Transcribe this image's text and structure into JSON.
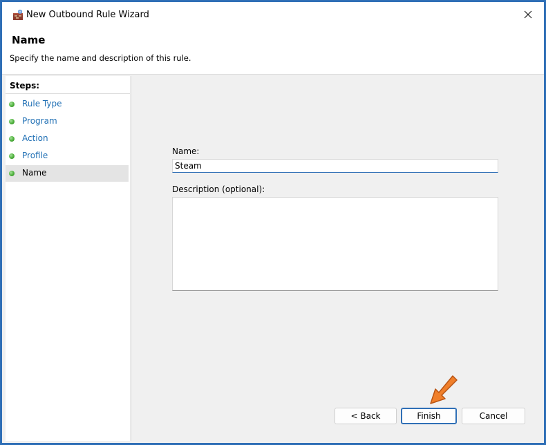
{
  "window": {
    "title": "New Outbound Rule Wizard",
    "app_icon": "firewall-icon",
    "close_icon": "close-icon"
  },
  "header": {
    "title": "Name",
    "subtitle": "Specify the name and description of this rule."
  },
  "steps": {
    "title": "Steps:",
    "items": [
      {
        "label": "Rule Type",
        "active": false
      },
      {
        "label": "Program",
        "active": false
      },
      {
        "label": "Action",
        "active": false
      },
      {
        "label": "Profile",
        "active": false
      },
      {
        "label": "Name",
        "active": true
      }
    ]
  },
  "form": {
    "name_label": "Name:",
    "name_value": "Steam",
    "description_label": "Description (optional):",
    "description_value": ""
  },
  "buttons": {
    "back": "< Back",
    "finish": "Finish",
    "cancel": "Cancel"
  },
  "colors": {
    "accent": "#2f6fb6",
    "link": "#1f6fb4",
    "step_complete": "#4caf3a",
    "pointer": "#f07f2a"
  }
}
